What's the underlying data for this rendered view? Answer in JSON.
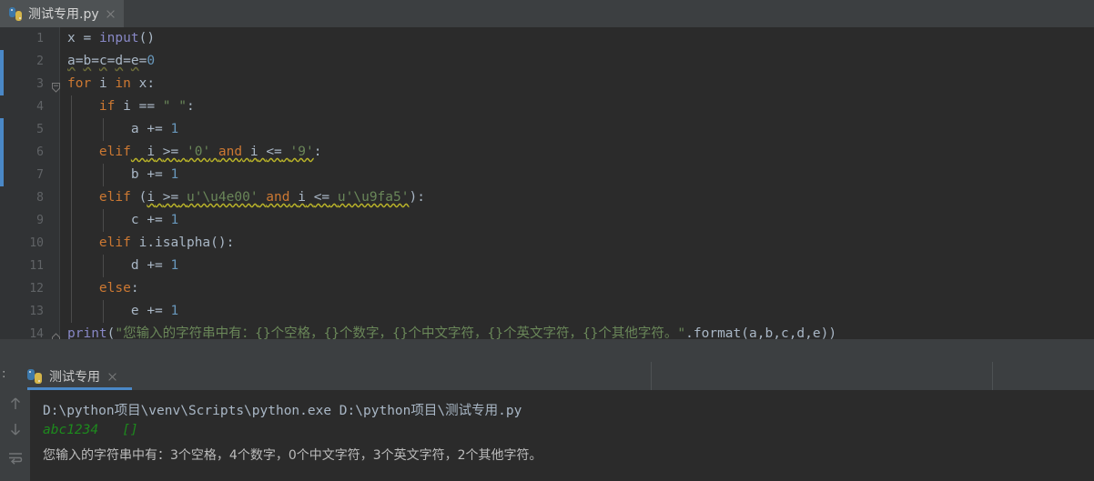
{
  "editor": {
    "tab": {
      "title": "测试专用.py",
      "icon": "python-file-icon",
      "close": "close-icon"
    },
    "lines": [
      {
        "n": "1",
        "text": "x = input()"
      },
      {
        "n": "2",
        "text": "a=b=c=d=e=0"
      },
      {
        "n": "3",
        "text": "for i in x:"
      },
      {
        "n": "4",
        "text": "    if i == \" \":"
      },
      {
        "n": "5",
        "text": "        a += 1"
      },
      {
        "n": "6",
        "text": "    elif  i >= '0' and i <= '9':"
      },
      {
        "n": "7",
        "text": "        b += 1"
      },
      {
        "n": "8",
        "text": "    elif (i >= u'\\u4e00' and i <= u'\\u9fa5'):"
      },
      {
        "n": "9",
        "text": "        c += 1"
      },
      {
        "n": "10",
        "text": "    elif i.isalpha():"
      },
      {
        "n": "11",
        "text": "        d += 1"
      },
      {
        "n": "12",
        "text": "    else:"
      },
      {
        "n": "13",
        "text": "        e += 1"
      },
      {
        "n": "14",
        "text": "print(\"您输入的字符串中有：{}个空格，{}个数字，{}个中文字符，{}个英文字符，{}个其他字符。\".format(a,b,c,d,e))"
      }
    ]
  },
  "run": {
    "label": ":",
    "tab": {
      "title": "测试专用",
      "icon": "python-run-icon",
      "close": "close-icon"
    },
    "toolbar": {
      "up": "up-arrow-icon",
      "down": "down-arrow-icon",
      "wrap": "soft-wrap-icon"
    },
    "console": {
      "command": "D:\\python项目\\venv\\Scripts\\python.exe D:\\python项目\\测试专用.py",
      "input_echo": "abc1234   []",
      "output": "您输入的字符串中有：3个空格，4个数字，0个中文字符，3个英文字符，2个其他字符。"
    }
  },
  "colors": {
    "editor_bg": "#2b2b2b",
    "panel_bg": "#3c3f41",
    "gutter_bg": "#313335",
    "keyword": "#cc7832",
    "string": "#6a8759",
    "number": "#6897bb",
    "identifier": "#a9b7c6",
    "builtin": "#8888c6",
    "warning_underline": "#bbb529",
    "accent": "#4a88c7",
    "console_input": "#1d8a1d",
    "console_text": "#bbbbbb"
  }
}
